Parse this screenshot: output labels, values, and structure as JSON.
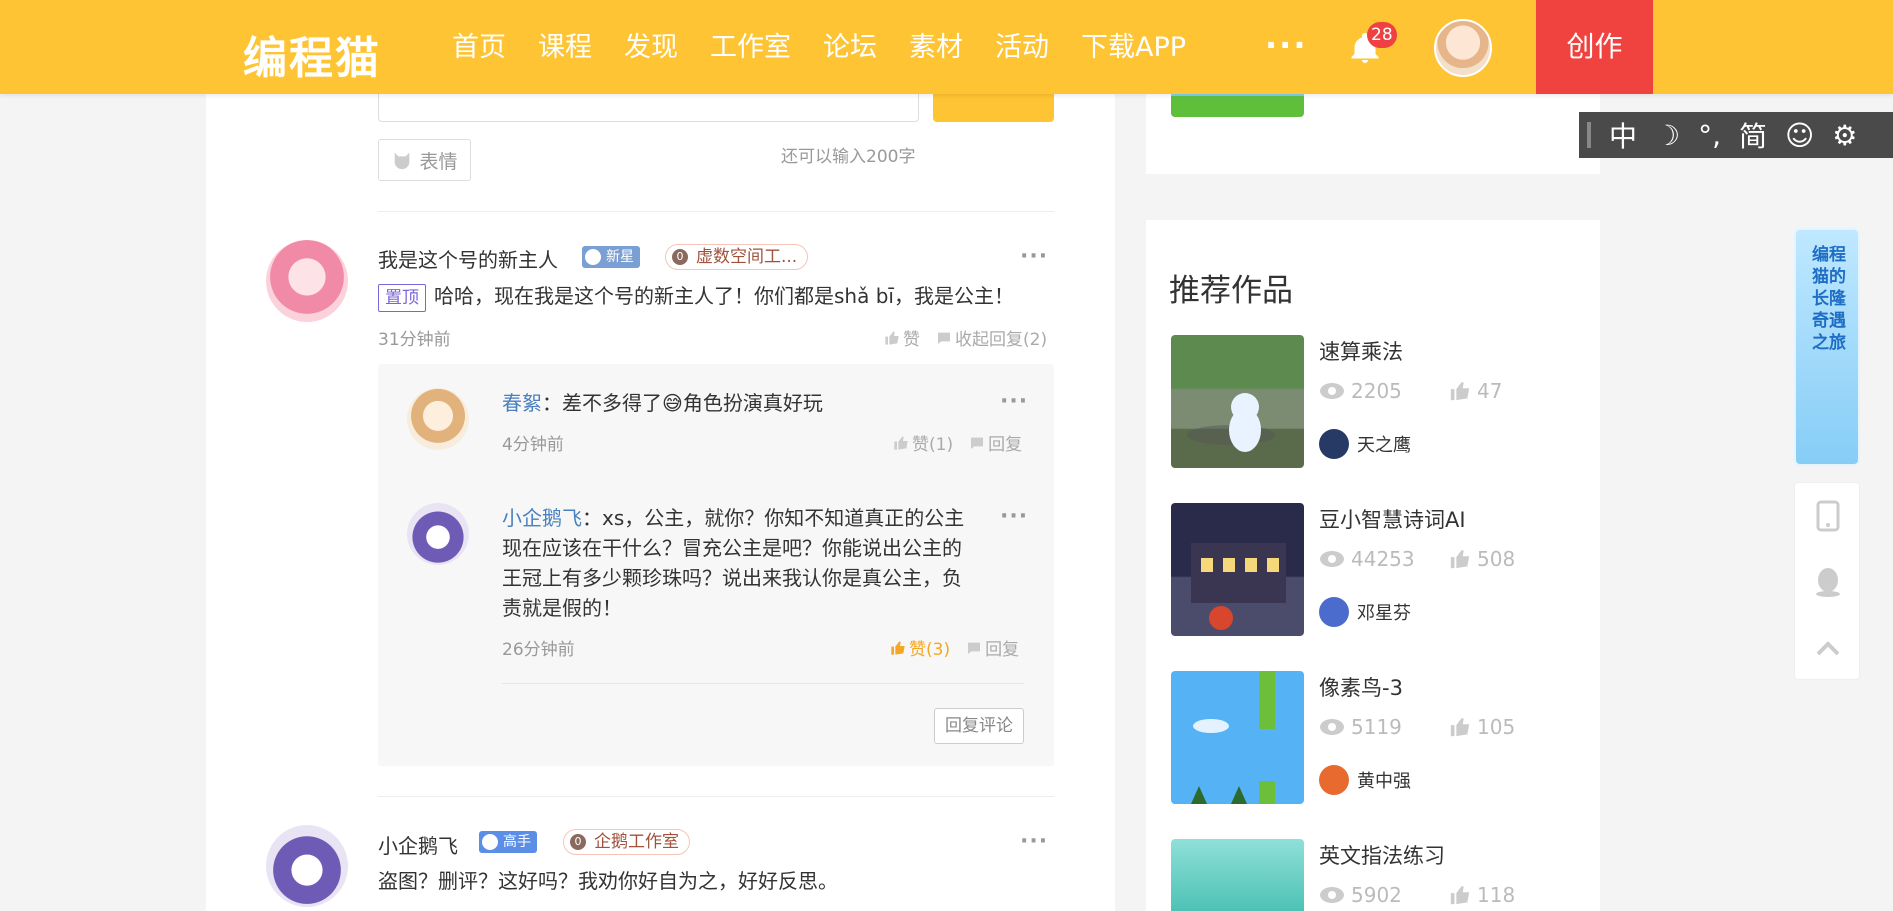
{
  "header": {
    "logo": "编程猫",
    "nav": [
      "首页",
      "课程",
      "发现",
      "工作室",
      "论坛",
      "素材",
      "活动",
      "下载APP"
    ],
    "more": "···",
    "notification_count": "28",
    "create_label": "创作"
  },
  "composer": {
    "emoji_label": "表情",
    "char_count": "还可以输入200字"
  },
  "comments": [
    {
      "author": "我是这个号的新主人",
      "level": "新星",
      "studio": "虚数空间工...",
      "pin": "置顶",
      "text": "哈哈，现在我是这个号的新主人了！你们都是shǎ bī，我是公主！",
      "time": "31分钟前",
      "like_label": "赞",
      "reply_toggle": "收起回复(2)",
      "replies": [
        {
          "author": "春絮",
          "sep": "：",
          "text": "差不多得了😅角色扮演真好玩",
          "time": "4分钟前",
          "like_label": "赞(1)",
          "reply_label": "回复"
        },
        {
          "author": "小企鹅飞",
          "sep": "：",
          "text": "xs，公主，就你？你知不知道真正的公主现在应该在干什么？冒充公主是吧？你能说出公主的王冠上有多少颗珍珠吗？说出来我认你是真公主，负责就是假的！",
          "time": "26分钟前",
          "like_label": "赞(3)",
          "reply_label": "回复"
        }
      ],
      "reply_comment_btn": "回复评论"
    },
    {
      "author": "小企鹅飞",
      "level": "高手",
      "studio": "企鹅工作室",
      "text": "盗图？删评？这好吗？我劝你好自为之，好好反思。"
    }
  ],
  "sidebar": {
    "recommend_title": "推荐作品",
    "works": [
      {
        "title": "速算乘法",
        "views": "2205",
        "likes": "47",
        "author": "天之鹰"
      },
      {
        "title": "豆小智慧诗词AI",
        "views": "44253",
        "likes": "508",
        "author": "邓星芬"
      },
      {
        "title": "像素鸟-3",
        "views": "5119",
        "likes": "105",
        "author": "黄中强"
      },
      {
        "title": "英文指法练习",
        "views": "5902",
        "likes": "118",
        "author": ""
      }
    ]
  },
  "ime": [
    "中",
    "☽",
    "°,",
    "简",
    "☺",
    "⚙"
  ],
  "banner_text": "编程猫的长隆奇遇之旅",
  "colors": {
    "brand": "#fec433",
    "create": "#f0433f",
    "liked": "#f5a623",
    "link": "#4a80bf"
  }
}
